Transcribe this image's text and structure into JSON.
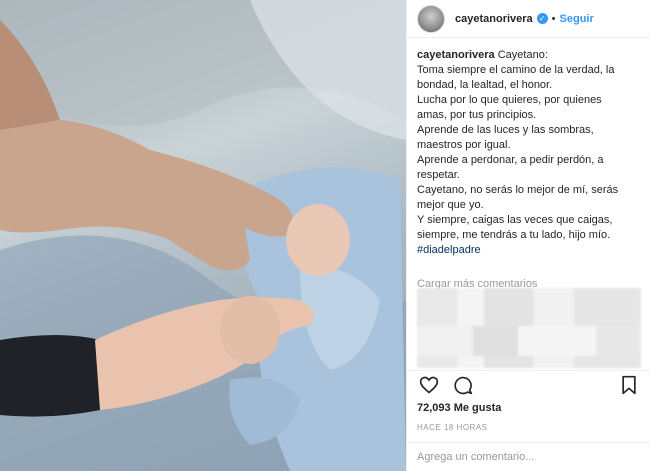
{
  "post": {
    "username": "cayetanorivera",
    "verified_glyph": "✓",
    "dot": "•",
    "follow_label": "Seguir"
  },
  "caption": {
    "username": "cayetanorivera",
    "lines": [
      " Cayetano:",
      "Toma siempre el camino de la verdad, la",
      "bondad, la lealtad, el honor.",
      "Lucha por lo que quieres, por quienes",
      "amas, por tus principios.",
      "Aprende de las luces y las sombras,",
      "maestros por igual.",
      "Aprende a perdonar, a pedir perdón, a",
      "respetar.",
      "Cayetano, no serás lo mejor de mí, serás",
      "mejor que yo.",
      "Y siempre, caigas las veces que caigas,",
      "siempre, me tendrás a tu lado, hijo mío."
    ],
    "hashtag": "#diadelpadre"
  },
  "comments": {
    "load_more": "Cargar más comentarios"
  },
  "actions": {
    "like_icon": "heart-icon",
    "comment_icon": "comment-icon",
    "save_icon": "bookmark-icon"
  },
  "stats": {
    "likes": "72,093 Me gusta",
    "time": "HACE 18 HORAS"
  },
  "comment_box": {
    "placeholder": "Agrega un comentario..."
  },
  "colors": {
    "link_blue": "#3897f0",
    "hashtag_blue": "#003569",
    "muted_gray": "#999999",
    "text": "#262626"
  }
}
